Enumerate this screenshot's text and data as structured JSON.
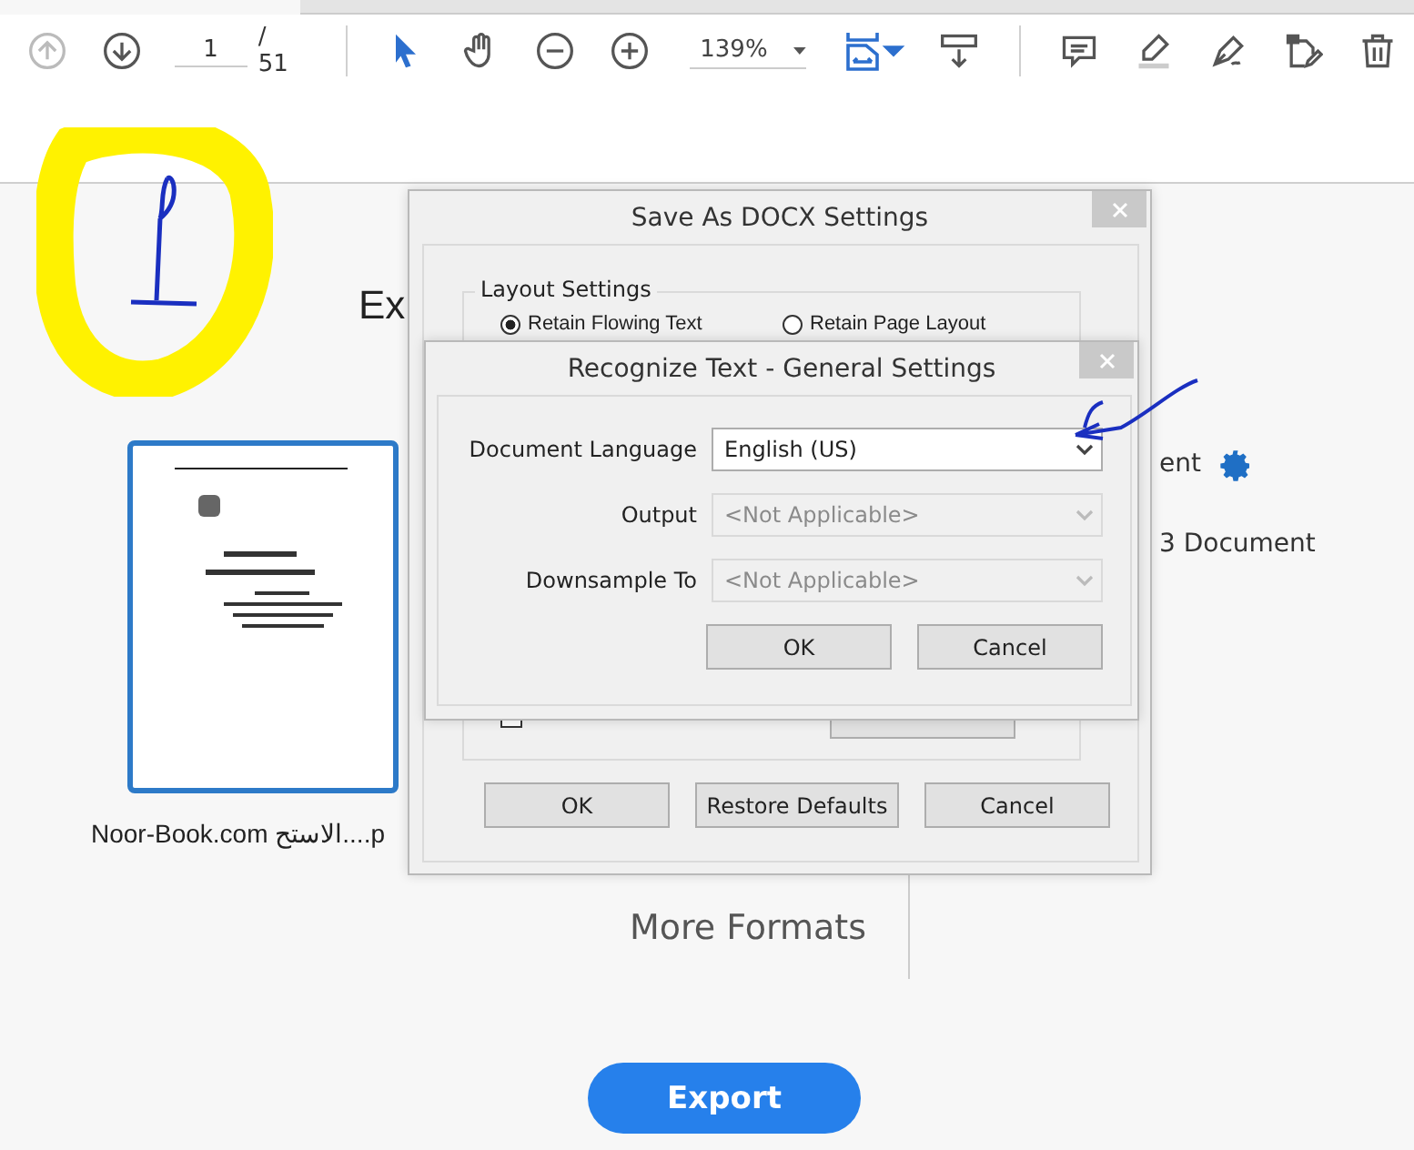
{
  "toolbar": {
    "tools": [
      {
        "kind": "prev",
        "disabled": true
      },
      {
        "kind": "next",
        "disabled": false
      },
      {
        "kind": "page",
        "value": "1",
        "total": "/ 51"
      },
      {
        "kind": "sep"
      },
      {
        "kind": "select",
        "selected": true
      },
      {
        "kind": "hand",
        "selected": false
      },
      {
        "kind": "zoomout"
      },
      {
        "kind": "zoomin"
      },
      {
        "kind": "zoom",
        "value": "139%"
      },
      {
        "kind": "fit"
      },
      {
        "kind": "scroll"
      },
      {
        "kind": "sep"
      },
      {
        "kind": "comment"
      },
      {
        "kind": "highlight"
      },
      {
        "kind": "sign"
      },
      {
        "kind": "edit"
      },
      {
        "kind": "delete"
      }
    ]
  },
  "export_panel": {
    "heading": "Ex",
    "file_caption": "Noor-Book.com  الاستح....p",
    "option_text": "ent",
    "option_sub": "3 Document",
    "more_formats": "More Formats",
    "export_button": "Export"
  },
  "docx_dialog": {
    "title": "Save As DOCX Settings",
    "group": "Layout Settings",
    "radios": [
      {
        "label": "Retain Flowing Text",
        "selected": true
      },
      {
        "label": "Retain Page Layout",
        "selected": false
      }
    ],
    "checkbox_checked": false,
    "buttons": [
      "OK",
      "Restore Defaults",
      "Cancel"
    ]
  },
  "ocr_dialog": {
    "title": "Recognize Text - General Settings",
    "fields": [
      {
        "label": "Document Language",
        "value": "English (US)",
        "disabled": false
      },
      {
        "label": "Output",
        "value": "<Not Applicable>",
        "disabled": true
      },
      {
        "label": "Downsample To",
        "value": "<Not Applicable>",
        "disabled": true
      }
    ],
    "buttons": [
      "OK",
      "Cancel"
    ]
  }
}
